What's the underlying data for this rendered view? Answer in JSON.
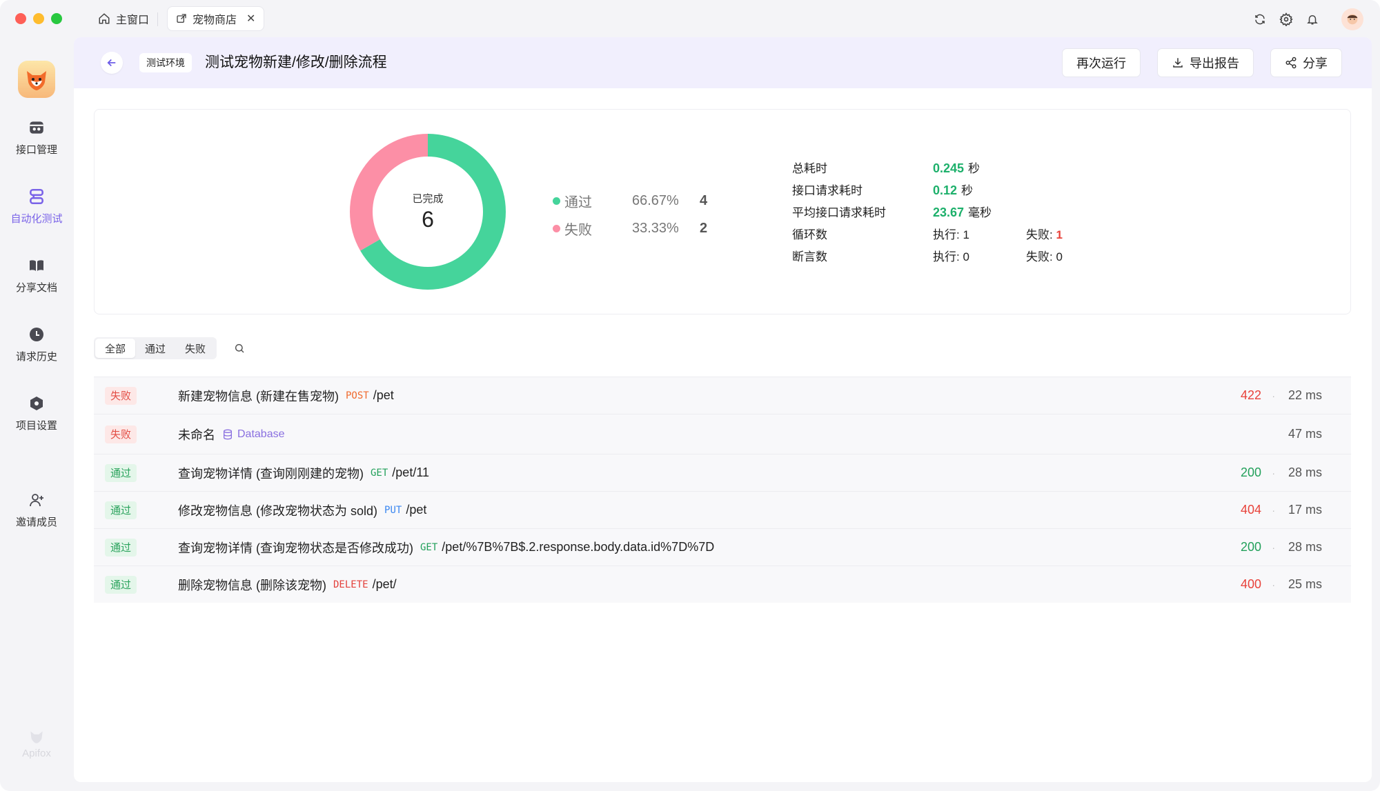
{
  "titlebar": {
    "tabs": [
      {
        "label": "主窗口",
        "icon": "home-icon"
      },
      {
        "label": "宠物商店",
        "icon": "external-link-icon",
        "close": "✕"
      }
    ]
  },
  "sidebar": {
    "items": [
      {
        "label": "接口管理",
        "icon": "api-icon"
      },
      {
        "label": "自动化测试",
        "icon": "automation-icon",
        "active": true
      },
      {
        "label": "分享文档",
        "icon": "book-icon"
      },
      {
        "label": "请求历史",
        "icon": "clock-icon"
      },
      {
        "label": "项目设置",
        "icon": "hexagon-icon"
      },
      {
        "label": "邀请成员",
        "icon": "add-user-icon"
      }
    ],
    "brand": "Apifox"
  },
  "header": {
    "env": "测试环境",
    "title": "测试宠物新建/修改/删除流程",
    "buttons": {
      "rerun": "再次运行",
      "export": "导出报告",
      "share": "分享"
    }
  },
  "summary": {
    "completed_label": "已完成",
    "completed_count": "6",
    "legend": [
      {
        "name": "通过",
        "percent": "66.67%",
        "count": "4",
        "color": "#45d49b"
      },
      {
        "name": "失败",
        "percent": "33.33%",
        "count": "2",
        "color": "#fc8fa6"
      }
    ],
    "stats": {
      "total_time_label": "总耗时",
      "total_time_value": "0.245",
      "total_time_unit": "秒",
      "req_time_label": "接口请求耗时",
      "req_time_value": "0.12",
      "req_time_unit": "秒",
      "avg_time_label": "平均接口请求耗时",
      "avg_time_value": "23.67",
      "avg_time_unit": "毫秒",
      "loops_label": "循环数",
      "loops_exec": "执行: 1",
      "loops_fail_label": "失败: ",
      "loops_fail_value": "1",
      "assert_label": "断言数",
      "assert_exec": "执行: 0",
      "assert_fail": "失败: 0"
    }
  },
  "chart_data": {
    "type": "pie",
    "categories": [
      "通过",
      "失败"
    ],
    "values": [
      4,
      2
    ],
    "colors": [
      "#45d49b",
      "#fc8fa6"
    ]
  },
  "filters": [
    "全部",
    "通过",
    "失败"
  ],
  "results": [
    {
      "status_label": "失败",
      "type": "fail",
      "name": "新建宠物信息 (新建在售宠物)",
      "method": "POST",
      "path": "/pet",
      "code": "422",
      "code_color": "red",
      "time": "22 ms"
    },
    {
      "status_label": "失败",
      "type": "fail",
      "name": "未命名",
      "db": "Database",
      "code": "",
      "time": "47 ms"
    },
    {
      "status_label": "通过",
      "type": "pass",
      "name": "查询宠物详情 (查询刚刚建的宠物)",
      "method": "GET",
      "path": "/pet/11",
      "code": "200",
      "code_color": "green",
      "time": "28 ms"
    },
    {
      "status_label": "通过",
      "type": "pass",
      "name": "修改宠物信息 (修改宠物状态为 sold)",
      "method": "PUT",
      "path": "/pet",
      "code": "404",
      "code_color": "red",
      "time": "17 ms"
    },
    {
      "status_label": "通过",
      "type": "pass",
      "name": "查询宠物详情 (查询宠物状态是否修改成功)",
      "method": "GET",
      "path": "/pet/%7B%7B$.2.response.body.data.id%7D%7D",
      "code": "200",
      "code_color": "green",
      "time": "28 ms"
    },
    {
      "status_label": "通过",
      "type": "pass",
      "name": "删除宠物信息 (删除该宠物)",
      "method": "DELETE",
      "path": "/pet/",
      "code": "400",
      "code_color": "red",
      "time": "25 ms"
    }
  ],
  "separator": "·"
}
